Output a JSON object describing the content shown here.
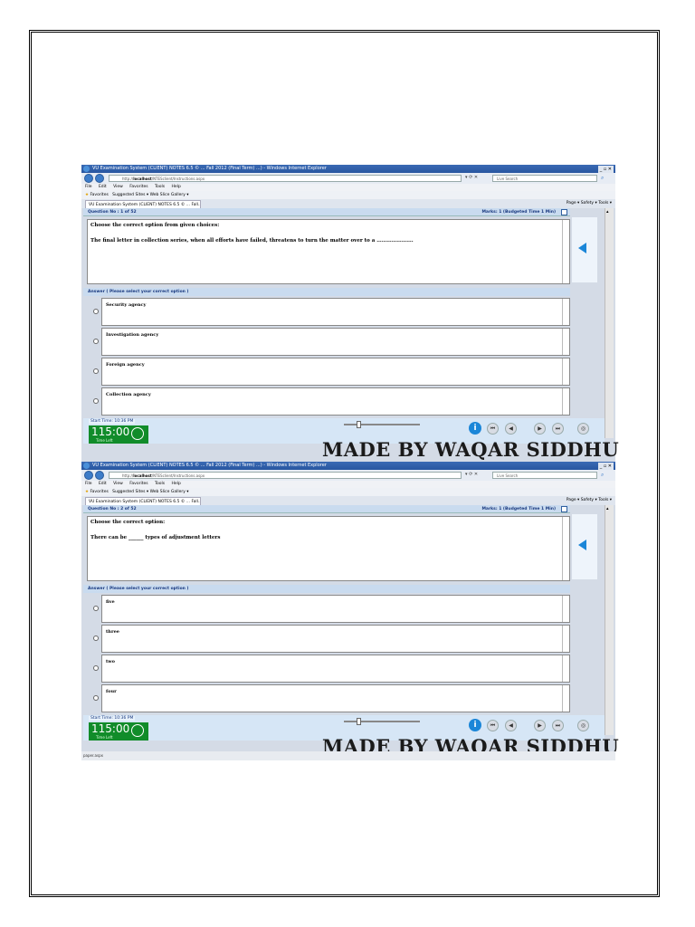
{
  "screenshots": [
    {
      "window_title": "VU Examination System (CLIENT) NOTES 6.5 © ... Fall 2012 (Final Term) ...) - Windows Internet Explorer",
      "url_prefix": "http://",
      "url_host": "localhost",
      "url_path": "/NTESclient/Instructions.aspx",
      "search_placeholder": "Live Search",
      "menu": [
        "File",
        "Edit",
        "View",
        "Favorites",
        "Tools",
        "Help"
      ],
      "favorites": "Favorites",
      "favbar_links": "Suggested Sites ▾   Web Slice Gallery ▾",
      "tab_title": "VU Examination System (CLIENT) NOTES 6.5 © ... Fall...",
      "cmdbar": "Page ▾  Safety ▾  Tools ▾",
      "question_no": "Question No : 1 of 52",
      "marks": "Marks: 1 (Budgeted Time 1 Min)",
      "instruction": "Choose the correct option from given choices:",
      "question": "The final letter in collection series, when all efforts have failed, threatens to turn the matter over to a ………………….",
      "answer_header": "Answer ( Please select your correct option )",
      "options": [
        "Security agency",
        "Investigation agency",
        "Foreign agency",
        "Collection agency"
      ],
      "start_time": "Start Time: 10:36 PM",
      "timer": "115:00",
      "time_left": "Time Left",
      "watermark": "MADE BY WAQAR SIDDHU",
      "status": ""
    },
    {
      "window_title": "VU Examination System (CLIENT) NOTES 6.5 © ... Fall 2012 (Final Term) ...) - Windows Internet Explorer",
      "url_prefix": "http://",
      "url_host": "localhost",
      "url_path": "/NTESclient/Instructions.aspx",
      "search_placeholder": "Live Search",
      "menu": [
        "File",
        "Edit",
        "View",
        "Favorites",
        "Tools",
        "Help"
      ],
      "favorites": "Favorites",
      "favbar_links": "Suggested Sites ▾   Web Slice Gallery ▾",
      "tab_title": "VU Examination System (CLIENT) NOTES 6.5 © ... Fall...",
      "cmdbar": "Page ▾  Safety ▾  Tools ▾",
      "question_no": "Question No : 2 of 52",
      "marks": "Marks: 1 (Budgeted Time 1 Min)",
      "instruction": "Choose the correct option:",
      "question": "There can be ______ types of adjustment letters",
      "answer_header": "Answer ( Please select your correct option )",
      "options": [
        "five",
        "three",
        "two",
        "four"
      ],
      "start_time": "Start Time: 10:36 PM",
      "timer": "115:00",
      "time_left": "Time Left",
      "watermark": "MADE BY WAQAR SIDDHU",
      "status": "paper.aspx"
    }
  ],
  "colors": {
    "timer_bg": "#118c2a",
    "header_bg": "#c9dbef",
    "accent": "#1b86d8"
  }
}
